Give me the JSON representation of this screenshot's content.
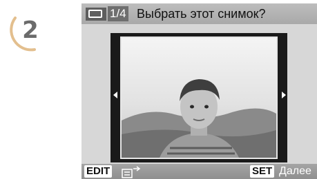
{
  "step": {
    "number": "2"
  },
  "screen": {
    "counter": "1/4",
    "title": "Выбрать этот снимок?",
    "edit_label": "EDIT",
    "set_label": "SET",
    "next_label": "Далее"
  },
  "icons": {
    "select_frame": "single-image-icon",
    "list": "list-arrow-icon",
    "prev": "left-arrow-icon",
    "next": "right-arrow-icon"
  },
  "colors": {
    "topbar": "#b3b3b3",
    "bottombar": "#9a9a9a",
    "frame": "#1a1a1a",
    "step_ring": "#e7c79b"
  }
}
